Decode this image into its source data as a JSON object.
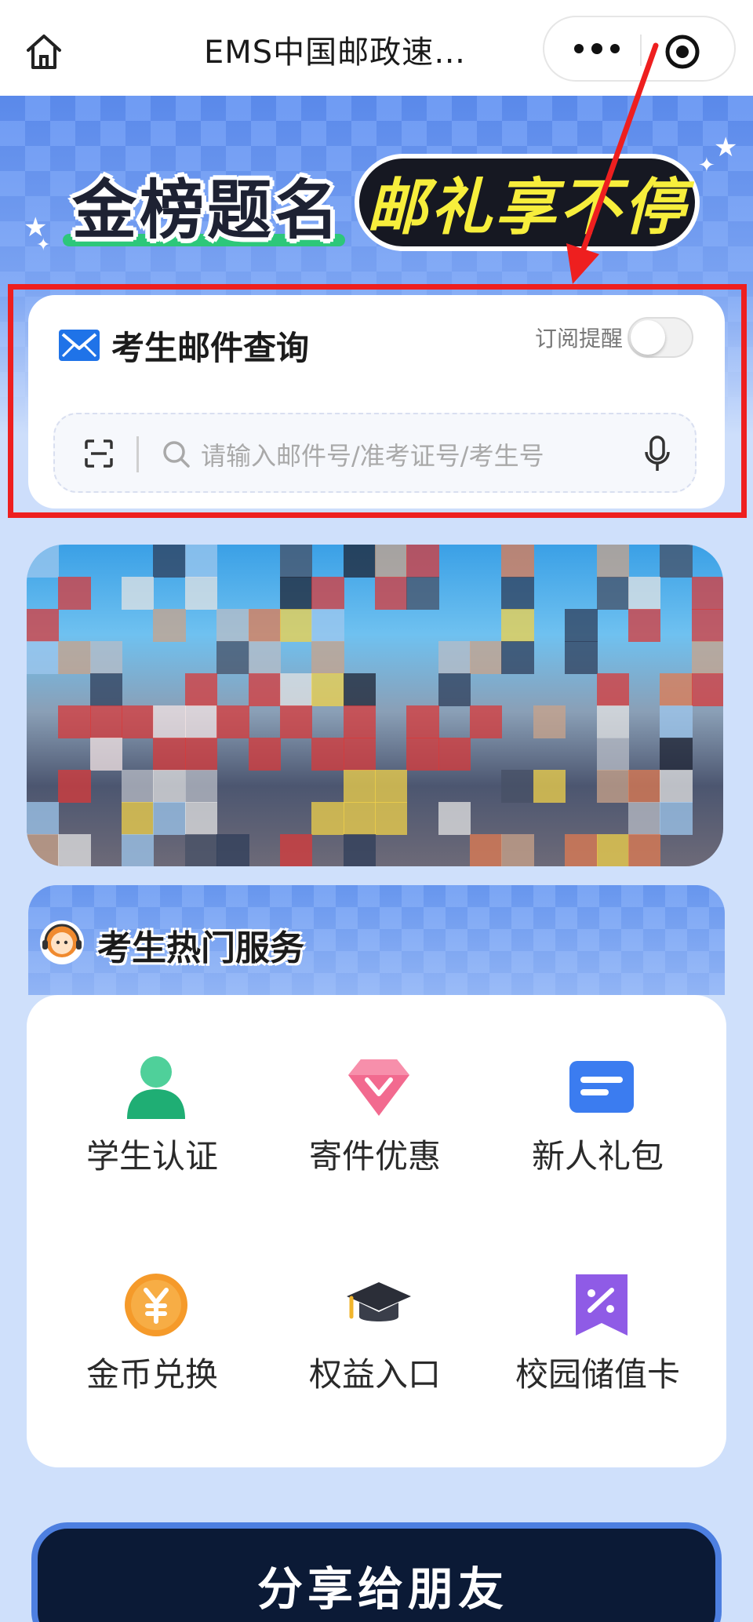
{
  "nav": {
    "title": "EMS中国邮政速…",
    "home_icon": "home-icon",
    "more_icon": "more-dots-icon",
    "close_icon": "miniprogram-close-icon"
  },
  "hero": {
    "left_text": "金榜题名",
    "right_text": "邮礼享不停",
    "colors": {
      "accent_green": "#2dc77a",
      "accent_yellow": "#f7ee3c",
      "pill_dark": "#161822"
    }
  },
  "query": {
    "title": "考生邮件查询",
    "subscribe_label": "订阅提醒",
    "subscribe_on": false,
    "search_placeholder": "请输入邮件号/准考证号/考生号",
    "mail_icon": "mail-icon",
    "scan_icon": "scan-icon",
    "search_icon": "search-icon",
    "mic_icon": "microphone-icon"
  },
  "annotation": {
    "color": "#ee1f1f"
  },
  "services": {
    "title": "考生热门服务",
    "items": [
      {
        "label": "学生认证",
        "icon": "student-person-icon"
      },
      {
        "label": "寄件优惠",
        "icon": "diamond-discount-icon"
      },
      {
        "label": "新人礼包",
        "icon": "card-list-icon"
      },
      {
        "label": "金币兑换",
        "icon": "yuan-coin-icon"
      },
      {
        "label": "权益入口",
        "icon": "graduation-cap-icon"
      },
      {
        "label": "校园储值卡",
        "icon": "percent-ribbon-icon"
      }
    ]
  },
  "share": {
    "label": "分享给朋友"
  }
}
